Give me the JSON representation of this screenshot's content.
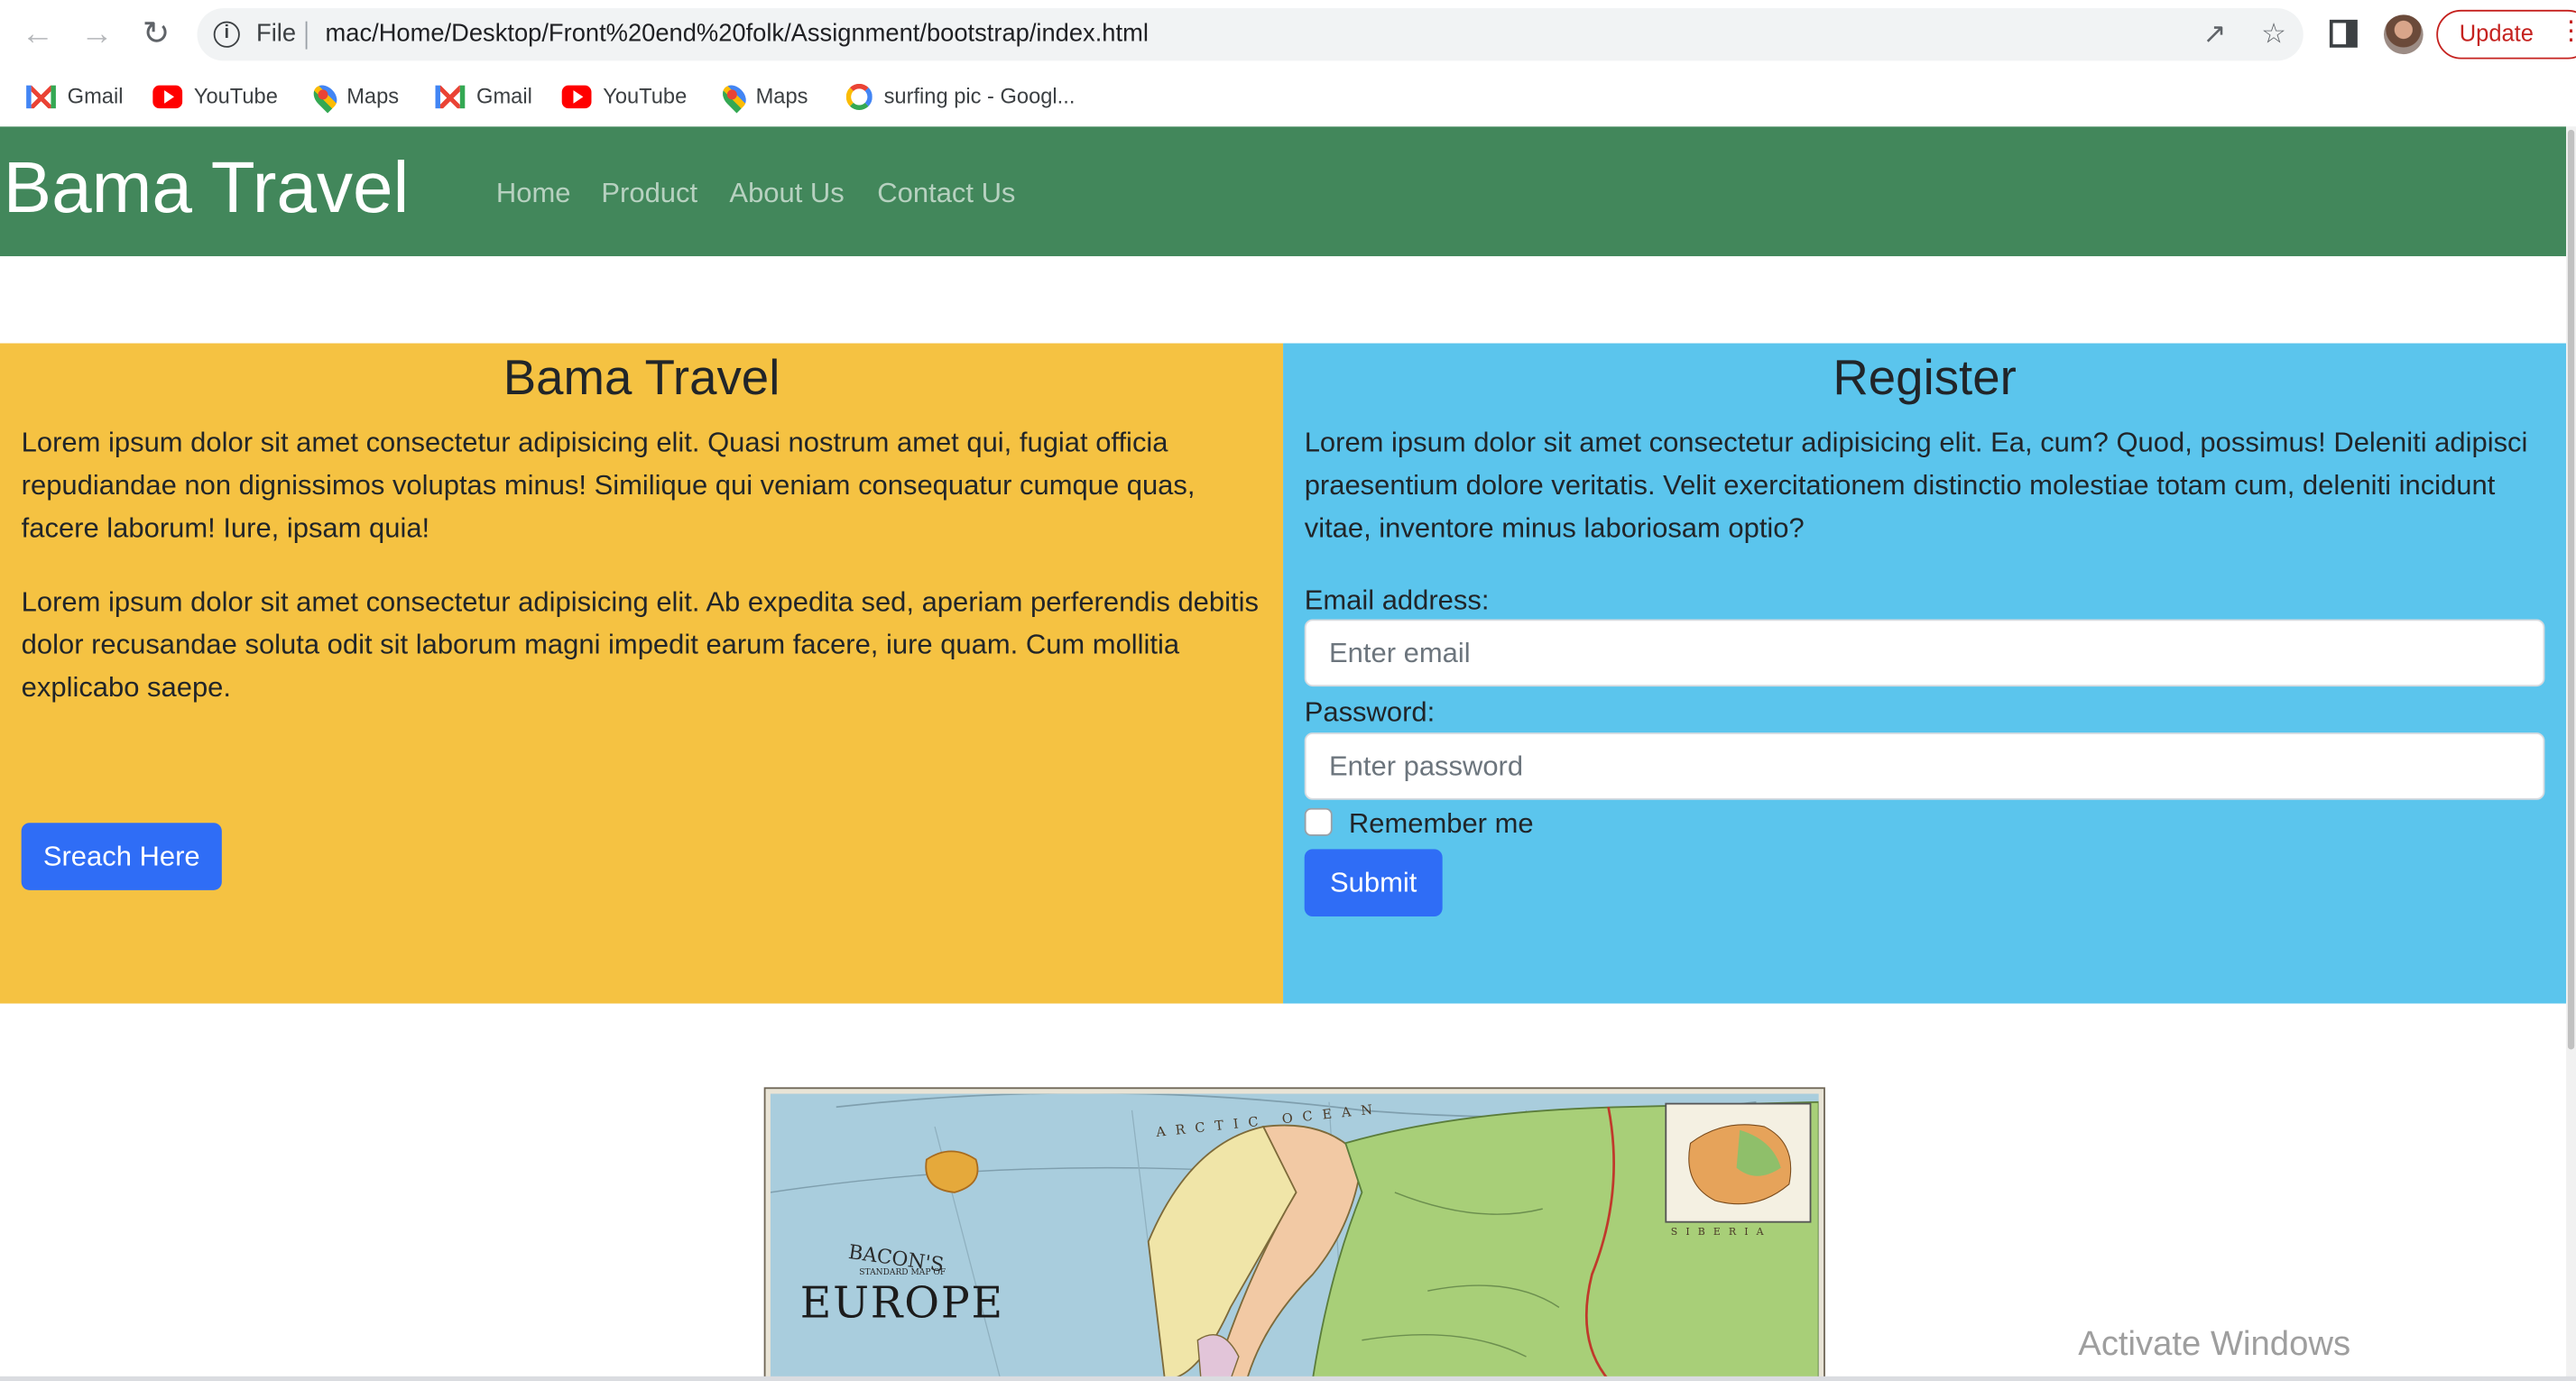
{
  "browser": {
    "file_label": "File",
    "url": "mac/Home/Desktop/Front%20end%20folk/Assignment/bootstrap/index.html",
    "update_label": "Update",
    "bookmarks": [
      {
        "label": "Gmail",
        "icon": "gmail-icon"
      },
      {
        "label": "YouTube",
        "icon": "youtube-icon"
      },
      {
        "label": "Maps",
        "icon": "maps-icon"
      },
      {
        "label": "Gmail",
        "icon": "gmail-icon"
      },
      {
        "label": "YouTube",
        "icon": "youtube-icon"
      },
      {
        "label": "Maps",
        "icon": "maps-icon"
      },
      {
        "label": "surfing pic - Googl...",
        "icon": "google-icon"
      }
    ]
  },
  "navbar": {
    "brand": "Bama Travel",
    "links": [
      "Home",
      "Product",
      "About Us",
      "Contact Us"
    ],
    "background": "#42875b"
  },
  "left_section": {
    "title": "Bama Travel",
    "paragraphs": [
      "Lorem ipsum dolor sit amet consectetur adipisicing elit. Quasi nostrum amet qui, fugiat officia repudiandae non dignissimos voluptas minus! Similique qui veniam consequatur cumque quas, facere laborum! Iure, ipsam quia!",
      "Lorem ipsum dolor sit amet consectetur adipisicing elit. Ab expedita sed, aperiam perferendis debitis dolor recusandae soluta odit sit laborum magni impedit earum facere, iure quam. Cum mollitia explicabo saepe."
    ],
    "button_label": "Sreach Here",
    "background": "#f5c242"
  },
  "register_section": {
    "title": "Register",
    "paragraph": "Lorem ipsum dolor sit amet consectetur adipisicing elit. Ea, cum? Quod, possimus! Deleniti adipisci praesentium dolore veritatis. Velit exercitationem distinctio molestiae totam cum, deleniti incidunt vitae, inventore minus laboriosam optio?",
    "email_label": "Email address:",
    "email_placeholder": "Enter email",
    "password_label": "Password:",
    "password_placeholder": "Enter password",
    "remember_label": "Remember me",
    "submit_label": "Submit",
    "background": "#5bc5ed"
  },
  "map_image": {
    "top_text": "ARCTIC OCEAN",
    "brand_text": "BACON'S",
    "sub_text": "STANDARD MAP OF",
    "title_text": "EUROPE",
    "siberia_text": "SIBERIA"
  },
  "watermark": "Activate Windows"
}
